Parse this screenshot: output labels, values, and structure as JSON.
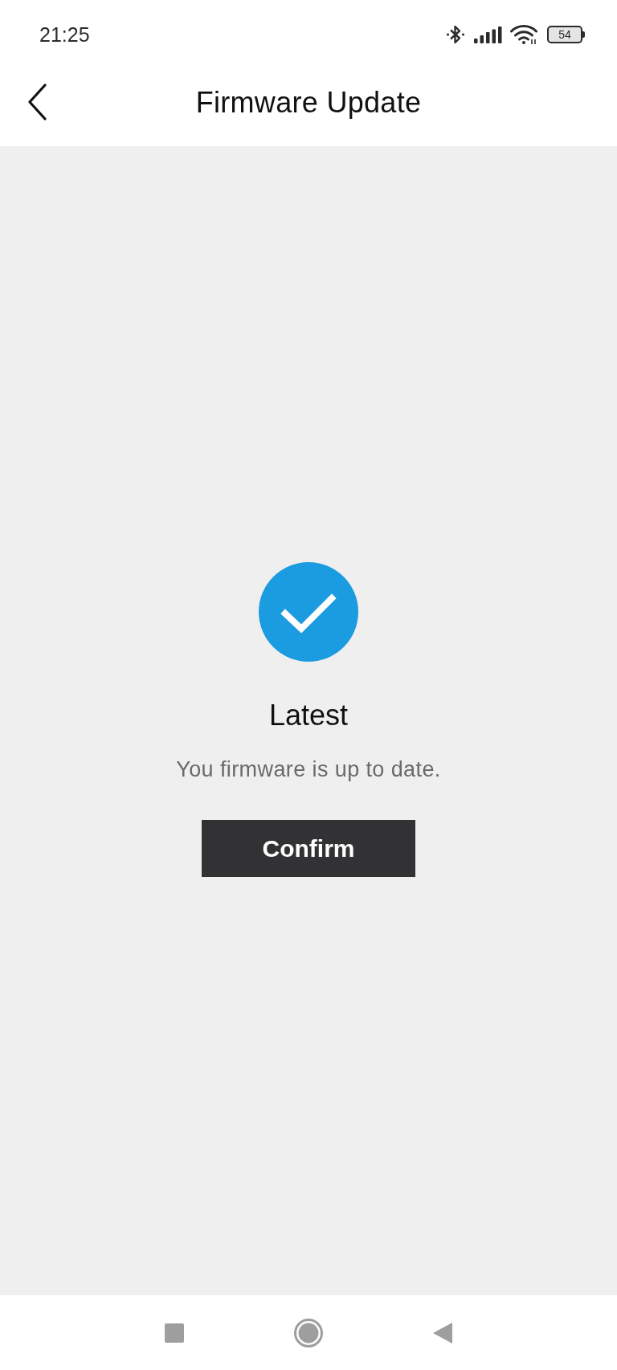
{
  "status_bar": {
    "time": "21:25",
    "battery": "54"
  },
  "header": {
    "title": "Firmware Update"
  },
  "result": {
    "title": "Latest",
    "message": "You firmware is up to date.",
    "button": "Confirm"
  }
}
